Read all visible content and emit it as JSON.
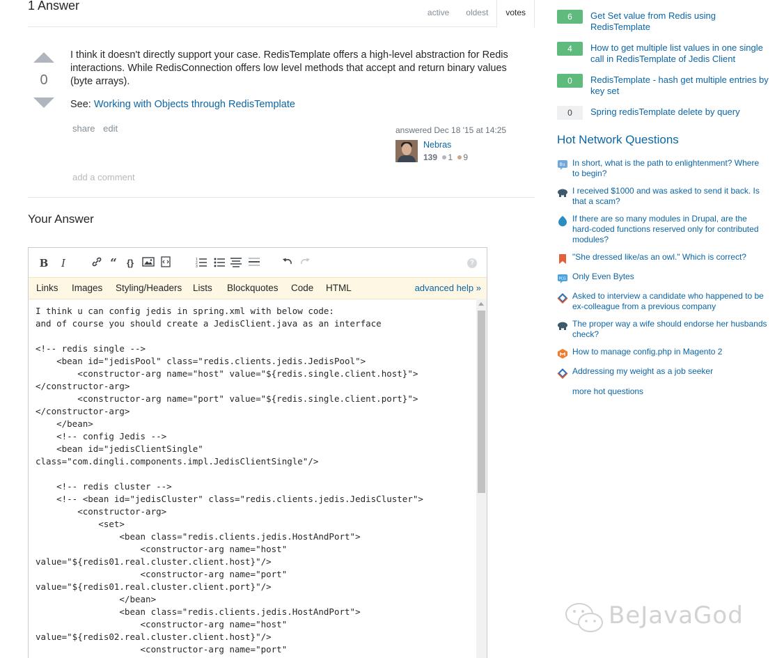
{
  "answers": {
    "count_label": "1 Answer",
    "sort_tabs": [
      "active",
      "oldest",
      "votes"
    ],
    "active_sort": "votes"
  },
  "answer": {
    "score": "0",
    "body": "I think it doesn't directly support your case. RedisTemplate offers a high-level abstraction for Redis interactions. While RedisConnection offers low level methods that accept and return binary values (byte arrays).",
    "see_prefix": "See:",
    "see_link": "Working with Objects through RedisTemplate",
    "menu": [
      "share",
      "edit"
    ],
    "answered_label": "answered Dec 18 '15 at 14:25",
    "user_name": "Nebras",
    "user_rep": "139",
    "silver_badges": "1",
    "bronze_badges": "9",
    "add_comment": "add a comment"
  },
  "your_answer": {
    "title": "Your Answer",
    "toolbar_icons": [
      "bold-icon",
      "italic-icon",
      "link-icon",
      "blockquote-icon",
      "code-icon",
      "image-icon",
      "snippet-icon",
      "ordered-list-icon",
      "bulleted-list-icon",
      "heading-icon",
      "horizontal-rule-icon",
      "undo-icon",
      "redo-icon",
      "help-icon"
    ],
    "help_links": [
      "Links",
      "Images",
      "Styling/Headers",
      "Lists",
      "Blockquotes",
      "Code",
      "HTML"
    ],
    "advanced_help": "advanced help »",
    "editor_content": "I think u can config jedis in spring.xml with below code:\nand of course you should create a JedisClient.java as an interface\n\n<!-- redis single -->\n    <bean id=\"jedisPool\" class=\"redis.clients.jedis.JedisPool\">\n        <constructor-arg name=\"host\" value=\"${redis.single.client.host}\">\n</constructor-arg>\n        <constructor-arg name=\"port\" value=\"${redis.single.client.port}\">\n</constructor-arg>\n    </bean>\n    <!-- config Jedis -->\n    <bean id=\"jedisClientSingle\"\nclass=\"com.dingli.components.impl.JedisClientSingle\"/>\n\n    <!-- redis cluster -->\n    <!-- <bean id=\"jedisCluster\" class=\"redis.clients.jedis.JedisCluster\">\n        <constructor-arg>\n            <set>\n                <bean class=\"redis.clients.jedis.HostAndPort\">\n                    <constructor-arg name=\"host\"\nvalue=\"${redis01.real.cluster.client.host}\"/>\n                    <constructor-arg name=\"port\"\nvalue=\"${redis01.real.cluster.client.port}\"/>\n                </bean>\n                <bean class=\"redis.clients.jedis.HostAndPort\">\n                    <constructor-arg name=\"host\"\nvalue=\"${redis02.real.cluster.client.host}\"/>\n                    <constructor-arg name=\"port\""
  },
  "related": [
    {
      "score": "6",
      "answered": true,
      "title": "Get Set value from Redis using RedisTemplate"
    },
    {
      "score": "4",
      "answered": true,
      "title": "How to get multiple list values in one single call in RedisTemplate of Jedis Client"
    },
    {
      "score": "0",
      "answered": true,
      "title": "RedisTemplate - hash get multiple entries by key set"
    },
    {
      "score": "0",
      "answered": false,
      "title": "Spring redisTemplate delete by query"
    }
  ],
  "hot_network": {
    "title": "Hot Network Questions",
    "items": [
      {
        "icon": "buddhism-site-icon",
        "title": "In short, what is the path to enlightenment? Where to begin?"
      },
      {
        "icon": "personal-finance-site-icon",
        "title": "I received $1000 and was asked to send it back. Is that a scam?"
      },
      {
        "icon": "drupal-site-icon",
        "title": "If there are so many modules in Drupal, are the hard-coded functions reserved only for contributed modules?"
      },
      {
        "icon": "english-site-icon",
        "title": "\"She dressed like/as an owl.\" Which is correct?"
      },
      {
        "icon": "code-golf-site-icon",
        "title": "Only Even Bytes"
      },
      {
        "icon": "workplace-site-icon",
        "title": "Asked to interview a candidate who happened to be ex-colleague from a previous company"
      },
      {
        "icon": "personal-finance-site-icon",
        "title": "The proper way a wife should endorse her husbands check?"
      },
      {
        "icon": "magento-site-icon",
        "title": "How to manage config.php in Magento 2"
      },
      {
        "icon": "workplace-site-icon",
        "title": "Addressing my weight as a job seeker"
      }
    ],
    "more": "more hot questions"
  },
  "watermark": "BeJavaGod"
}
